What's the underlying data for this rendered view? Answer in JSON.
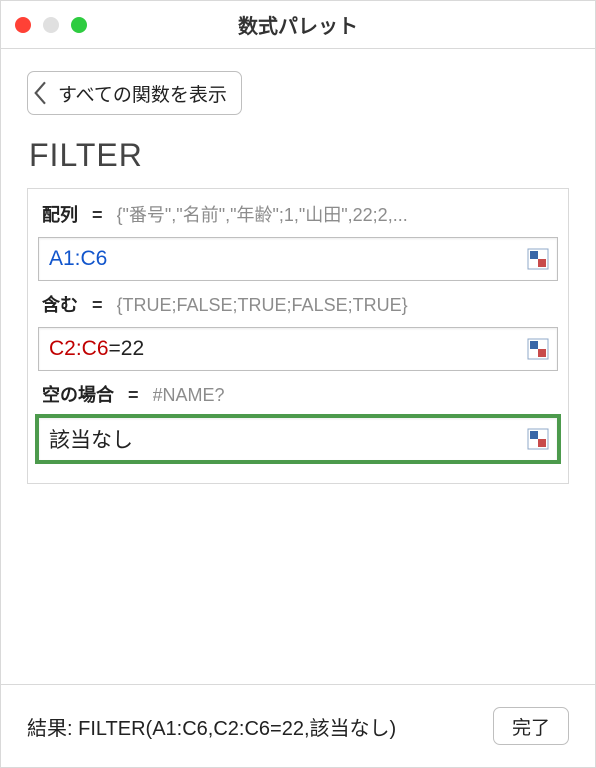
{
  "window": {
    "title": "数式パレット"
  },
  "back": {
    "label": "すべての関数を表示"
  },
  "function_name": "FILTER",
  "args": [
    {
      "label": "配列",
      "preview": "{\"番号\",\"名前\",\"年齢\";1,\"山田\",22;2,...",
      "display_ref": "A1:C6",
      "display_plain": "",
      "ref_color": "blue",
      "active": false
    },
    {
      "label": "含む",
      "preview": "{TRUE;FALSE;TRUE;FALSE;TRUE}",
      "display_ref": "C2:C6",
      "display_plain": "=22",
      "ref_color": "red",
      "active": false
    },
    {
      "label": "空の場合",
      "preview": "#NAME?",
      "display_ref": "",
      "display_plain": "該当なし",
      "ref_color": "",
      "active": true
    }
  ],
  "footer": {
    "result_label": "結果:",
    "result_formula": "FILTER(A1:C6,C2:C6=22,該当なし)",
    "done_label": "完了"
  }
}
